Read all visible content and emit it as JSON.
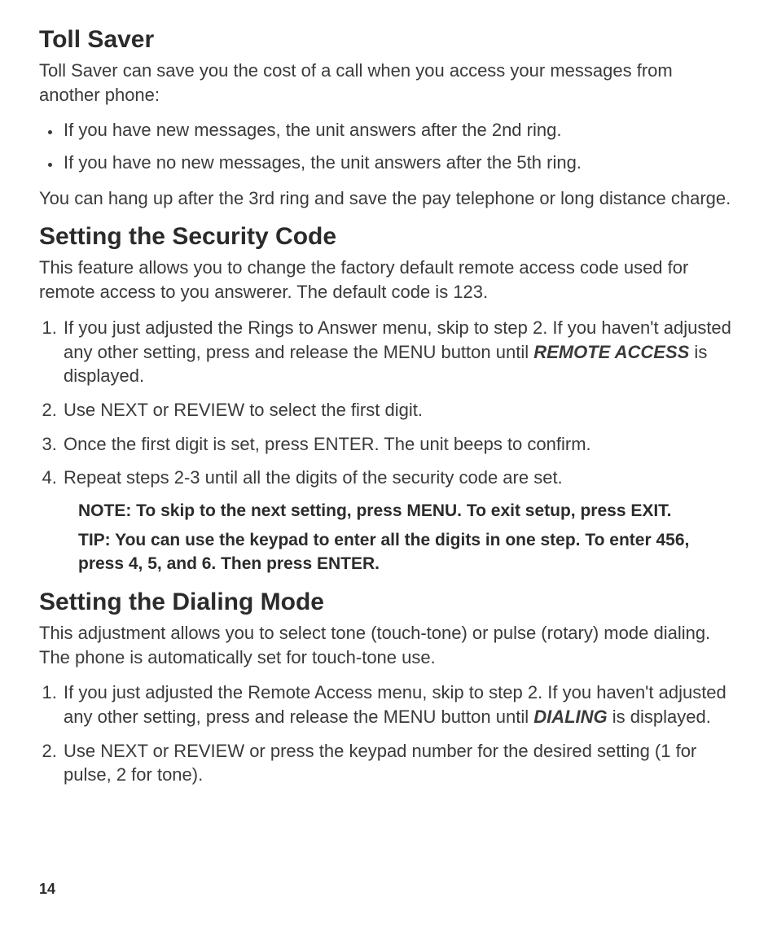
{
  "sections": {
    "tollSaver": {
      "heading": "Toll Saver",
      "intro": "Toll Saver can save you the cost of a call when you access your messages from another phone:",
      "bullets": [
        "If you have new messages, the unit answers after the 2nd ring.",
        "If you have no new messages, the unit answers after the 5th ring."
      ],
      "closing": "You can hang up after the 3rd ring and save the pay telephone or long distance charge."
    },
    "securityCode": {
      "heading": "Setting the Security Code",
      "intro": "This feature allows you to change the factory default remote access code used for remote access to you answerer. The default code is 123.",
      "step1_pre": "If you just adjusted the Rings to Answer menu, skip to step 2. If you haven't adjusted any other setting, press and release the MENU button until ",
      "step1_bold": "REMOTE ACCESS",
      "step1_post": " is displayed.",
      "step2": "Use NEXT or REVIEW to select the first digit.",
      "step3": "Once the first digit is set, press ENTER. The unit beeps to confirm.",
      "step4": "Repeat steps 2-3 until all the digits of the security code are set.",
      "note": "NOTE: To skip to the next setting, press MENU. To exit setup, press EXIT.",
      "tip": "TIP: You can use the keypad to enter all the digits in one step. To enter 456, press 4, 5, and 6. Then press ENTER."
    },
    "dialingMode": {
      "heading": "Setting the Dialing Mode",
      "intro": "This adjustment allows you to select tone (touch-tone) or pulse (rotary) mode dialing. The phone is automatically set for touch-tone use.",
      "step1_pre": "If you just adjusted the Remote Access menu, skip to step 2. If you haven't adjusted any other setting, press and release the MENU button until ",
      "step1_bold": "DIALING",
      "step1_post": " is displayed.",
      "step2": "Use NEXT or REVIEW or press the keypad number for the desired setting (1 for pulse, 2 for tone)."
    }
  },
  "pageNumber": "14"
}
